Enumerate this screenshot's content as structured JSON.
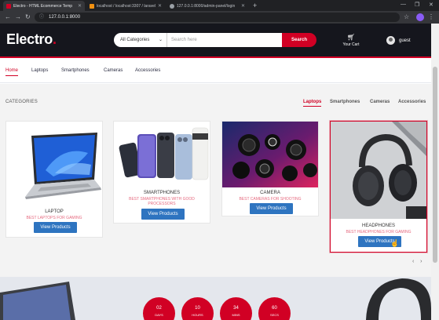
{
  "browser": {
    "tabs": [
      {
        "title": "Electro - HTML Ecommerce Temp",
        "favicon_color": "#d10024",
        "active": true
      },
      {
        "title": "localhost / localhost:3307 / laravel",
        "favicon_color": "#f29111",
        "active": false
      },
      {
        "title": "127.0.0.1:8000/admin-panel/login",
        "favicon_color": "#9aa0a6",
        "active": false
      }
    ],
    "address": "127.0.0.1:8000"
  },
  "header": {
    "logo_text": "Electro",
    "logo_dot": ".",
    "search": {
      "category_value": "All Categories",
      "placeholder": "Search here",
      "button_label": "Search"
    },
    "cart_label": "Your Cart",
    "user_label": "guest"
  },
  "nav": {
    "links": [
      "Home",
      "Laptops",
      "Smartphones",
      "Cameras",
      "Accessories"
    ],
    "active": "Home"
  },
  "categories": {
    "title": "CATEGORIES",
    "tabs": [
      "Laptops",
      "Smartphones",
      "Cameras",
      "Accessories"
    ],
    "active_tab": "Laptops",
    "cards": [
      {
        "name": "LAPTOP",
        "subtitle": "BEST LAPTOPS FOR GAMING",
        "button": "View Products"
      },
      {
        "name": "SMARTPHONES",
        "subtitle": "BEST SMARTPHONES WITH GOOD PROCESSORS",
        "button": "View Products"
      },
      {
        "name": "CAMERA",
        "subtitle": "BEST CAMERAS FOR SHOOTING",
        "button": "View Products"
      },
      {
        "name": "HEADPHONES",
        "subtitle": "BEST HEADPHONES FOR GAMING",
        "button": "View Products"
      }
    ],
    "arrows": [
      "‹",
      "›"
    ]
  },
  "countdown": [
    {
      "value": "02",
      "label": "DAYS"
    },
    {
      "value": "10",
      "label": "HOURS"
    },
    {
      "value": "34",
      "label": "MINS"
    },
    {
      "value": "60",
      "label": "SECS"
    }
  ],
  "colors": {
    "accent": "#d10024",
    "header_bg": "#15161d",
    "button_blue": "#2e74c0"
  }
}
